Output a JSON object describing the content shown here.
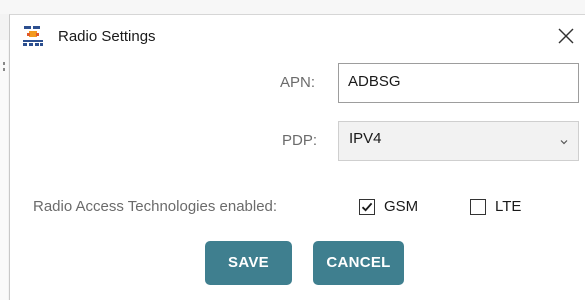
{
  "window": {
    "title": "Radio Settings",
    "app_icon": "lte-logo-icon",
    "close_icon": "close-icon"
  },
  "form": {
    "apn": {
      "label": "APN:",
      "value": "ADBSG"
    },
    "pdp": {
      "label": "PDP:",
      "selected": "IPV4",
      "icon": "chevron-down-icon"
    },
    "rat": {
      "label": "Radio Access Technologies enabled:",
      "options": [
        {
          "label": "GSM",
          "checked": true
        },
        {
          "label": "LTE",
          "checked": false
        }
      ]
    }
  },
  "buttons": {
    "save": "SAVE",
    "cancel": "CANCEL"
  },
  "colors": {
    "button_bg": "#3f7f8f",
    "button_text": "#ffffff",
    "label_text": "#6b6b6b"
  }
}
